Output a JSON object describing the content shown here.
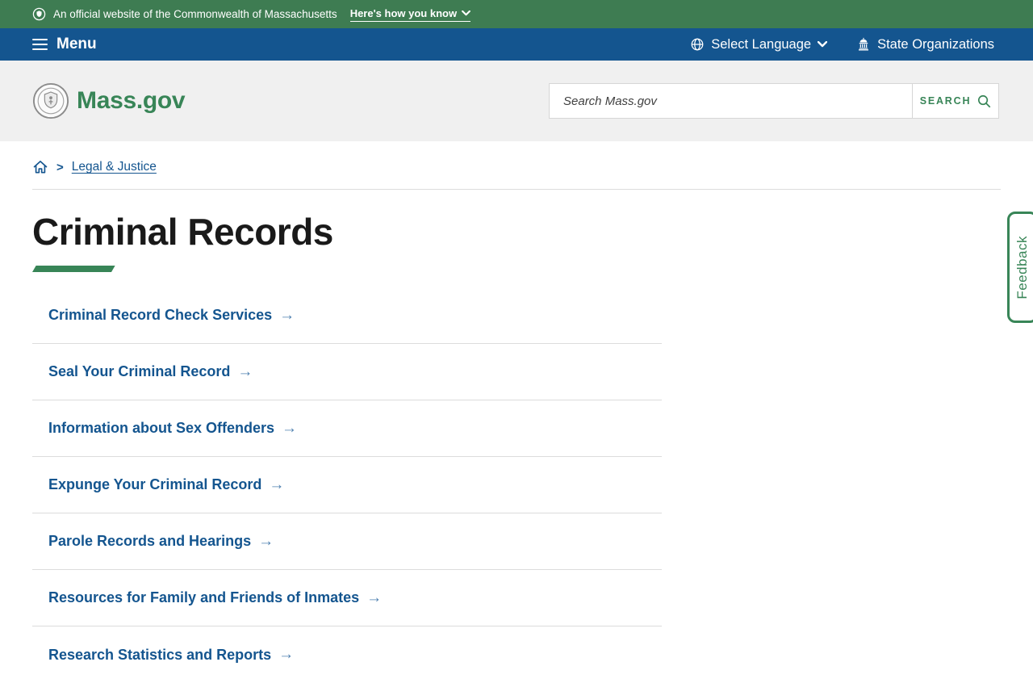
{
  "banner": {
    "official_text": "An official website of the Commonwealth of Massachusetts",
    "how_you_know_label": "Here's how you know"
  },
  "menubar": {
    "menu_label": "Menu",
    "select_language_label": "Select Language",
    "state_organizations_label": "State Organizations"
  },
  "header": {
    "site_name": "Mass.gov",
    "search": {
      "placeholder": "Search Mass.gov",
      "button_label": "SEARCH"
    }
  },
  "breadcrumb": {
    "separator": ">",
    "current": "Legal & Justice"
  },
  "page": {
    "title": "Criminal Records"
  },
  "topic_links": [
    "Criminal Record Check Services",
    "Seal Your Criminal Record",
    "Information about Sex Offenders",
    "Expunge Your Criminal Record",
    "Parole Records and Hearings",
    "Resources for Family and Friends of Inmates",
    "Research Statistics and Reports"
  ],
  "icons": {
    "arrow_right": "→"
  },
  "feedback": {
    "label": "Feedback"
  },
  "colors": {
    "banner_green": "#3e7c52",
    "accent_green": "#388557",
    "bar_blue": "#14558F",
    "link_blue": "#14558F",
    "arrow_blue": "#4f81b0",
    "header_gray": "#f0f0f0",
    "title_text": "#1a1a1a",
    "divider": "#dcdcdc"
  }
}
